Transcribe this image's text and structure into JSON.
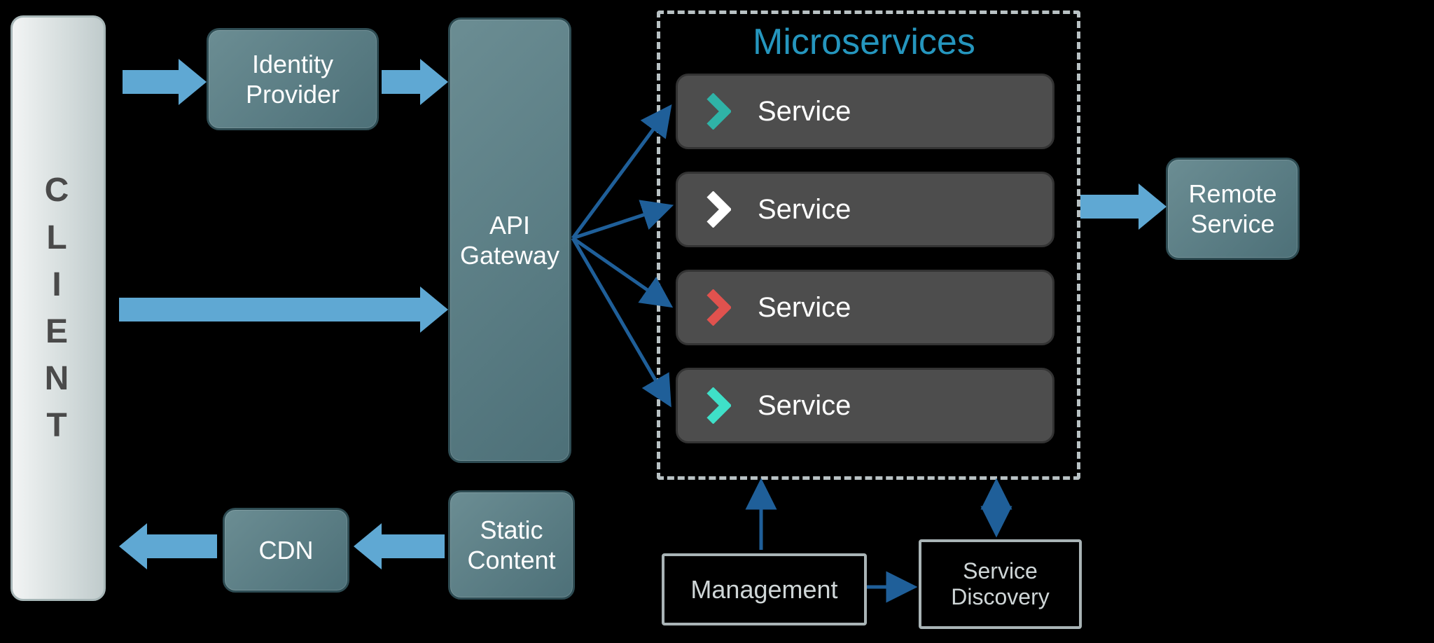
{
  "client_label": "CLIENT",
  "identity_provider": "Identity\nProvider",
  "api_gateway": "API\nGateway",
  "cdn": "CDN",
  "static_content": "Static\nContent",
  "remote_service": "Remote\nService",
  "microservices_title": "Microservices",
  "services": [
    {
      "label": "Service",
      "icon_color": "#2fb3a7"
    },
    {
      "label": "Service",
      "icon_color": "#ffffff"
    },
    {
      "label": "Service",
      "icon_color": "#e0524e"
    },
    {
      "label": "Service",
      "icon_color": "#3fe0c8"
    }
  ],
  "management": "Management",
  "service_discovery": "Service\nDiscovery",
  "colors": {
    "teal_box": "#5a7e84",
    "block_arrow": "#5fa8d3",
    "thin_arrow": "#1f5f99",
    "title_blue": "#2596be"
  }
}
